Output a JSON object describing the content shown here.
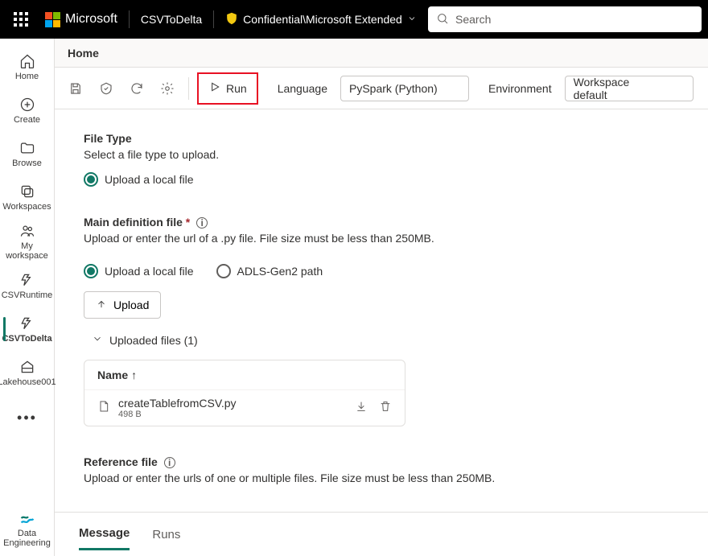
{
  "brand": "Microsoft",
  "app_name": "CSVToDelta",
  "confidential_label": "Confidential\\Microsoft Extended",
  "search_placeholder": "Search",
  "rail": {
    "home": "Home",
    "create": "Create",
    "browse": "Browse",
    "workspaces": "Workspaces",
    "my_workspace": "My workspace",
    "csvruntime": "CSVRuntime",
    "csvtodelta": "CSVToDelta",
    "lakehouse": "Lakehouse001",
    "data_eng": "Data Engineering"
  },
  "breadcrumb": "Home",
  "toolbar": {
    "run": "Run",
    "language_label": "Language",
    "language_value": "PySpark (Python)",
    "env_label": "Environment",
    "env_value": "Workspace default"
  },
  "file_type": {
    "title": "File Type",
    "desc": "Select a file type to upload.",
    "opt_local": "Upload a local file"
  },
  "main_def": {
    "title": "Main definition file",
    "desc": "Upload or enter the url of a .py file. File size must be less than 250MB.",
    "opt_local": "Upload a local file",
    "opt_adls": "ADLS-Gen2 path",
    "upload_btn": "Upload",
    "uploaded_label": "Uploaded files (1)",
    "col_name": "Name",
    "file_name": "createTablefromCSV.py",
    "file_size": "498 B"
  },
  "ref": {
    "title": "Reference file",
    "desc": "Upload or enter the urls of one or multiple files. File size must be less than 250MB."
  },
  "tabs": {
    "message": "Message",
    "runs": "Runs"
  }
}
